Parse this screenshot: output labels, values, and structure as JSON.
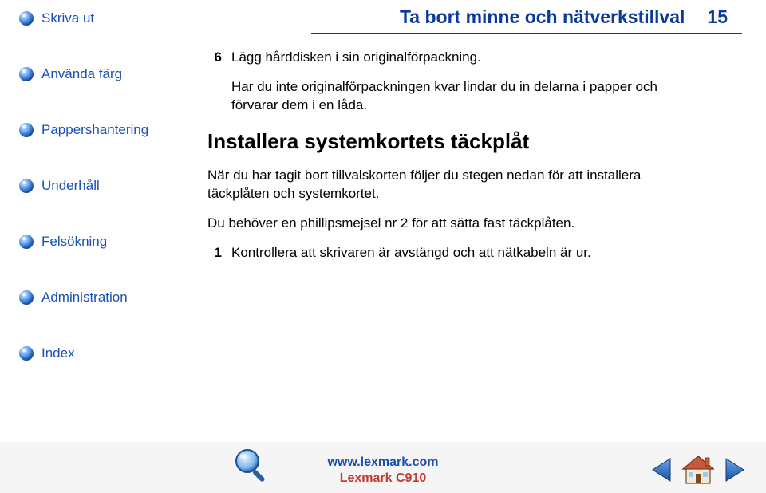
{
  "sidebar": {
    "items": [
      {
        "label": "Skriva ut"
      },
      {
        "label": "Använda färg"
      },
      {
        "label": "Pappershantering"
      },
      {
        "label": "Underhåll"
      },
      {
        "label": "Felsökning"
      },
      {
        "label": "Administration"
      },
      {
        "label": "Index"
      }
    ]
  },
  "header": {
    "title": "Ta bort minne och nätverkstillval",
    "page": "15"
  },
  "content": {
    "step6_num": "6",
    "step6_text": "Lägg hårddisken i sin originalförpackning.",
    "step6_note": "Har du inte originalförpackningen kvar lindar du in delarna i papper och förvarar dem i en låda.",
    "subheading": "Installera systemkortets täckplåt",
    "para1": "När du har tagit bort tillvalskorten följer du stegen nedan för att installera täckplåten och systemkortet.",
    "para2": "Du behöver en phillipsmejsel nr 2 för att sätta fast täckplåten.",
    "step1_num": "1",
    "step1_text": "Kontrollera att skrivaren är avstängd och att nätkabeln är ur."
  },
  "footer": {
    "link": "www.lexmark.com",
    "product": "Lexmark C910"
  },
  "icons": {
    "bullet": "sphere-bullet-icon",
    "search": "magnifier-icon",
    "prev": "arrow-left-icon",
    "home": "home-icon",
    "next": "arrow-right-icon"
  }
}
